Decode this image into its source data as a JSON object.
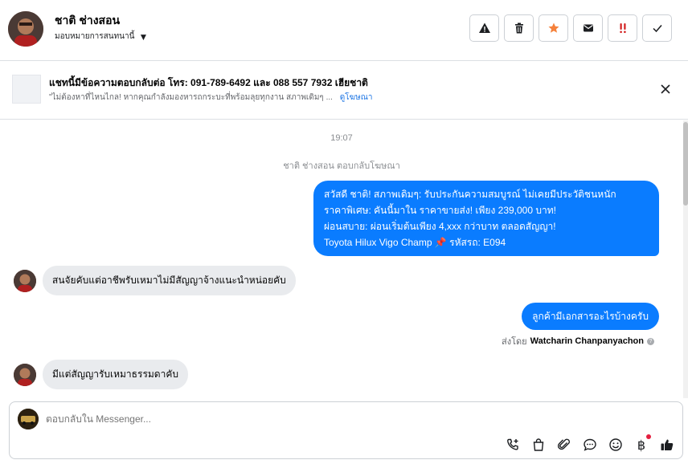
{
  "header": {
    "contact_name": "ชาติ ช่างสอน",
    "assign_label": "มอบหมายการสนทนานี้",
    "actions": [
      "warning-icon",
      "trash-icon",
      "star-icon",
      "mail-icon",
      "priority-icon",
      "check-icon"
    ]
  },
  "banner": {
    "title": "แชทนี้มีข้อความตอบกลับต่อ โทร: 091-789-6492 และ 088 557 7932 เฮียชาติ",
    "subtitle": "\"ไม่ต้องหาที่ไหนไกล! หากคุณกำลังมองหารถกระบะที่พร้อมลุยทุกงาน สภาพเดิมๆ ...",
    "link": "ดูโฆษณา"
  },
  "thread": {
    "time": "19:07",
    "system_note": "ชาติ ช่างสอน ตอบกลับโฆษณา",
    "messages": [
      {
        "direction": "out",
        "lines": [
          "สวัสดี ชาติ! สภาพเดิมๆ: รับประกันความสมบูรณ์ ไม่เคยมีประวัติชนหนัก",
          "ราคาพิเศษ: คันนี้มาใน ราคาขายส่ง! เพียง 239,000 บาท!",
          "ผ่อนสบาย: ผ่อนเริ่มต้นเพียง 4,xxx กว่าบาท ตลอดสัญญา!",
          "Toyota Hilux Vigo Champ 📌 รหัสรถ: E094"
        ]
      },
      {
        "direction": "in",
        "text": "สนจัยคับแต่อาชีพรับเหมาไม่มีสัญญาจ้างแนะนำหน่อยคับ"
      },
      {
        "direction": "out",
        "text": "ลูกค้ามีเอกสารอะไรบ้างครับ"
      },
      {
        "direction": "in",
        "text": "มีแต่สัญญารับเหมาธรรมดาคับ"
      }
    ],
    "sent_by_prefix": "ส่งโดย",
    "sent_by_name": "Watcharin Chanpanyachon"
  },
  "composer": {
    "placeholder": "ตอบกลับใน Messenger...",
    "tools": [
      "call-add-icon",
      "shopping-bag-icon",
      "paperclip-icon",
      "chat-bubble-icon",
      "emoji-icon",
      "baht-icon",
      "thumbs-up-icon"
    ],
    "baht_glyph": "฿"
  }
}
